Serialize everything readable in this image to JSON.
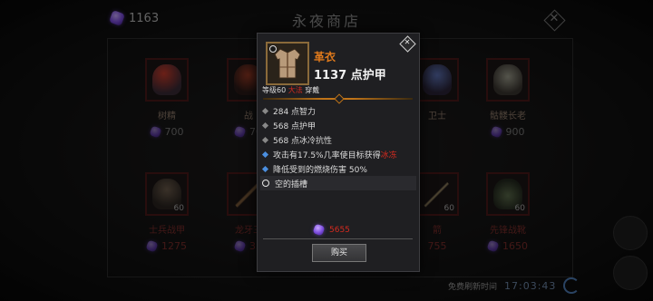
{
  "header": {
    "currency_amount": "1163",
    "title": "永夜商店"
  },
  "shop": {
    "items": [
      {
        "name": "树精",
        "price": "700",
        "level": "",
        "style": "normal"
      },
      {
        "name": "战",
        "price": "70",
        "level": "",
        "style": "normal"
      },
      {
        "name": "卫士",
        "price": "",
        "level": "",
        "style": "normal"
      },
      {
        "name": "骷髅长老",
        "price": "900",
        "level": "",
        "style": "normal"
      },
      {
        "name": "士兵战甲",
        "price": "1275",
        "level": "60",
        "style": "red"
      },
      {
        "name": "龙牙三",
        "price": "33",
        "level": "",
        "style": "red"
      },
      {
        "name": "箭",
        "price": "755",
        "level": "60",
        "style": "red"
      },
      {
        "name": "先锋战靴",
        "price": "1650",
        "level": "60",
        "style": "red"
      }
    ],
    "refresh_label": "免费刷新时间",
    "refresh_time": "17:03:43"
  },
  "tooltip": {
    "item_name": "革衣",
    "armor": "1137 点护甲",
    "req_level": "等级60",
    "req_class": "大法",
    "req_suffix": "穿戴",
    "stats": [
      {
        "text": "284 点智力",
        "bullet": "grey"
      },
      {
        "text": "568 点护甲",
        "bullet": "grey"
      },
      {
        "text": "568 点冰冷抗性",
        "bullet": "grey"
      }
    ],
    "proc_prefix": "攻击有17.5%几率使目标获得",
    "proc_effect": "冰冻",
    "fire_reduction": "降低受到的燃烧伤害 50%",
    "socket": "空的插槽",
    "price": "5655",
    "buy_label": "购买"
  },
  "colors": {
    "accent_orange": "#e07a1c",
    "warning_red": "#d42a1f",
    "stat_blue": "#4b8fe0",
    "timer_blue": "#6d87a8"
  }
}
